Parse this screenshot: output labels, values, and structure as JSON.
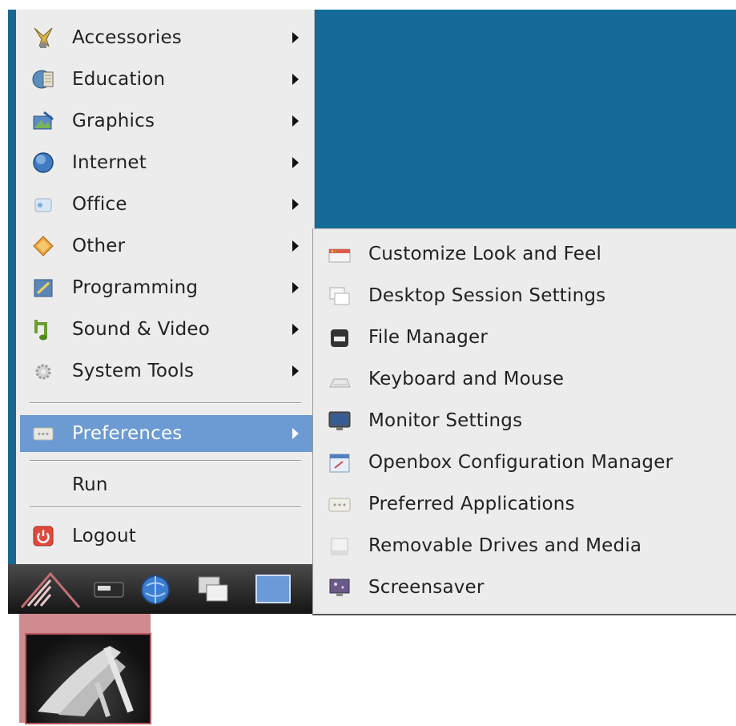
{
  "main_menu": {
    "items": [
      {
        "label": "Accessories",
        "icon": "accessories-icon"
      },
      {
        "label": "Education",
        "icon": "education-icon"
      },
      {
        "label": "Graphics",
        "icon": "graphics-icon"
      },
      {
        "label": "Internet",
        "icon": "internet-icon"
      },
      {
        "label": "Office",
        "icon": "office-icon"
      },
      {
        "label": "Other",
        "icon": "other-icon"
      },
      {
        "label": "Programming",
        "icon": "programming-icon"
      },
      {
        "label": "Sound & Video",
        "icon": "sound-video-icon"
      },
      {
        "label": "System Tools",
        "icon": "system-tools-icon"
      }
    ],
    "preferences": {
      "label": "Preferences",
      "icon": "preferences-icon",
      "selected": true
    },
    "run": {
      "label": "Run"
    },
    "logout": {
      "label": "Logout",
      "icon": "power-icon"
    }
  },
  "submenu": {
    "items": [
      {
        "label": "Customize Look and Feel",
        "icon": "appearance-icon"
      },
      {
        "label": "Desktop Session Settings",
        "icon": "session-icon"
      },
      {
        "label": "File Manager",
        "icon": "file-manager-icon"
      },
      {
        "label": "Keyboard and Mouse",
        "icon": "keyboard-icon"
      },
      {
        "label": "Monitor Settings",
        "icon": "monitor-icon"
      },
      {
        "label": "Openbox Configuration Manager",
        "icon": "openbox-icon"
      },
      {
        "label": "Preferred Applications",
        "icon": "preferred-apps-icon"
      },
      {
        "label": "Removable Drives and Media",
        "icon": "removable-drive-icon"
      },
      {
        "label": "Screensaver",
        "icon": "screensaver-icon"
      }
    ]
  },
  "taskbar": {
    "items": [
      "lxde-start-icon",
      "terminal-icon",
      "web-browser-icon",
      "window-switcher-icon",
      "desktop-icon"
    ]
  },
  "colors": {
    "desktop": "#156b97",
    "menu_bg": "#ececec",
    "highlight": "#6c9ad2",
    "callout": "#cf8a90"
  }
}
